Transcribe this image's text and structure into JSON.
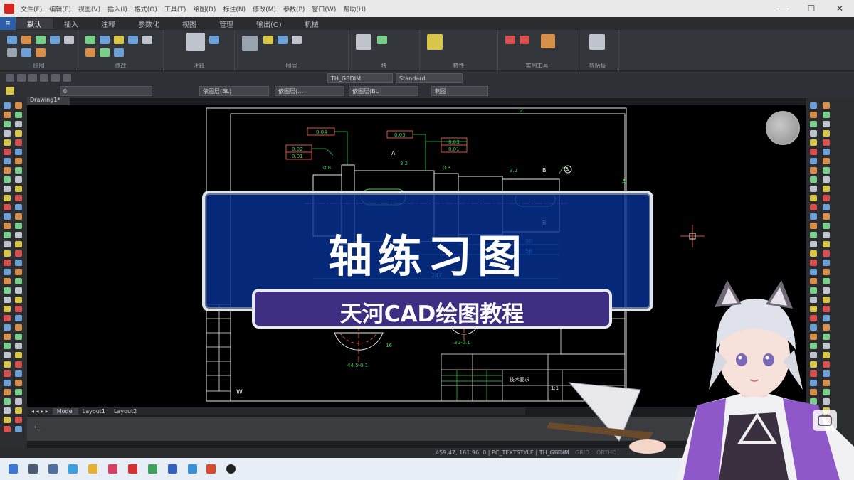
{
  "titlebar": {
    "menus": [
      "文件(F)",
      "编辑(E)",
      "视图(V)",
      "插入(I)",
      "格式(O)",
      "工具(T)",
      "绘图(D)",
      "标注(N)",
      "修改(M)",
      "参数(P)",
      "窗口(W)",
      "帮助(H)"
    ],
    "controls": [
      "—",
      "☐",
      "✕"
    ]
  },
  "ribbon": {
    "tabs": [
      "默认",
      "插入",
      "注释",
      "参数化",
      "视图",
      "管理",
      "输出(O)",
      "机械"
    ],
    "panel_titles": [
      "绘图",
      "修改",
      "注释",
      "图层",
      "块",
      "特性",
      "实用工具",
      "剪贴板"
    ]
  },
  "props": {
    "textstyle": "TH_GBDIM",
    "dimstyle": "Standard",
    "layer": "0",
    "color": "依图层(BL)",
    "linetype": "依图层(...",
    "lineweight": "依图层(BL",
    "plotstyle": "制图"
  },
  "file_tab": "Drawing1*",
  "layout_tabs": [
    "Model",
    "Layout1",
    "Layout2"
  ],
  "overlay": {
    "main_title": "轴练习图",
    "subtitle": "天河CAD绘图教程"
  },
  "status": {
    "coords": "459.47, 161.96, 0",
    "textstyle": "PC_TEXTSTYLE",
    "dimstyle": "TH_GBDIM",
    "toggles": [
      "SNAP",
      "GRID",
      "ORTHO"
    ]
  },
  "drawing": {
    "gtol": [
      "0.04",
      "0.03",
      "0.03",
      "0.01",
      "0.02",
      "0.01"
    ],
    "datums": [
      "A",
      "B",
      "A",
      "B",
      "A"
    ],
    "roughness": [
      "0.8",
      "3.2",
      "0.8",
      "3.2"
    ],
    "dims": [
      "90",
      "56",
      "16",
      "247",
      "30-0.1",
      "44.5-0.1"
    ],
    "zone_letters": [
      "2",
      "A"
    ],
    "title_block": [
      "技术要求",
      "1:1"
    ],
    "side_labels": [
      "W"
    ]
  },
  "colors": {
    "banner": "#0a3296",
    "subtitle_bg": "#3e2f82",
    "cad_green": "#38d048",
    "cad_cyan": "#39d0e0",
    "cad_red": "#e05040"
  }
}
